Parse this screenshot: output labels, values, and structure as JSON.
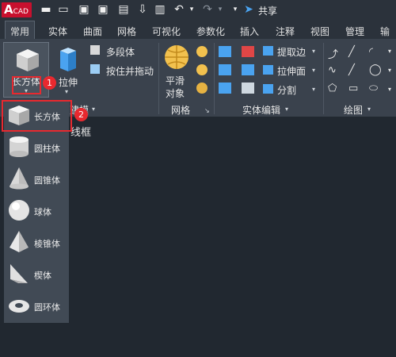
{
  "app": {
    "logo_letter": "A",
    "logo_text": "CAD"
  },
  "toolbar": {
    "share_label": "共享"
  },
  "tabs": [
    "常用",
    "实体",
    "曲面",
    "网格",
    "可视化",
    "参数化",
    "插入",
    "注释",
    "视图",
    "管理",
    "输出"
  ],
  "ribbon": {
    "box_button_label": "长方体",
    "extrude_label": "拉伸",
    "modeling_panel_title": "建模",
    "polysolid_label": "多段体",
    "presspull_label": "按住并拖动",
    "smooth_object_label_1": "平滑",
    "smooth_object_label_2": "对象",
    "mesh_panel_title": "网格",
    "extract_edges_label": "提取边",
    "extrude_face_label": "拉伸面",
    "slice_label": "分割",
    "solid_edit_panel_title": "实体编辑",
    "draw_panel_title": "绘图"
  },
  "viewport": {
    "label": "线框"
  },
  "dropdown": {
    "items": [
      {
        "label": "长方体",
        "icon": "box-icon"
      },
      {
        "label": "圆柱体",
        "icon": "cylinder-icon"
      },
      {
        "label": "圆锥体",
        "icon": "cone-icon"
      },
      {
        "label": "球体",
        "icon": "sphere-icon"
      },
      {
        "label": "棱锥体",
        "icon": "pyramid-icon"
      },
      {
        "label": "楔体",
        "icon": "wedge-icon"
      },
      {
        "label": "圆环体",
        "icon": "torus-icon"
      }
    ]
  },
  "annotations": {
    "step1": "1",
    "step2": "2"
  },
  "colors": {
    "accent_red": "#e8292f",
    "bg": "#212830",
    "ribbon": "#3a424d",
    "brand": "#c8102e"
  }
}
